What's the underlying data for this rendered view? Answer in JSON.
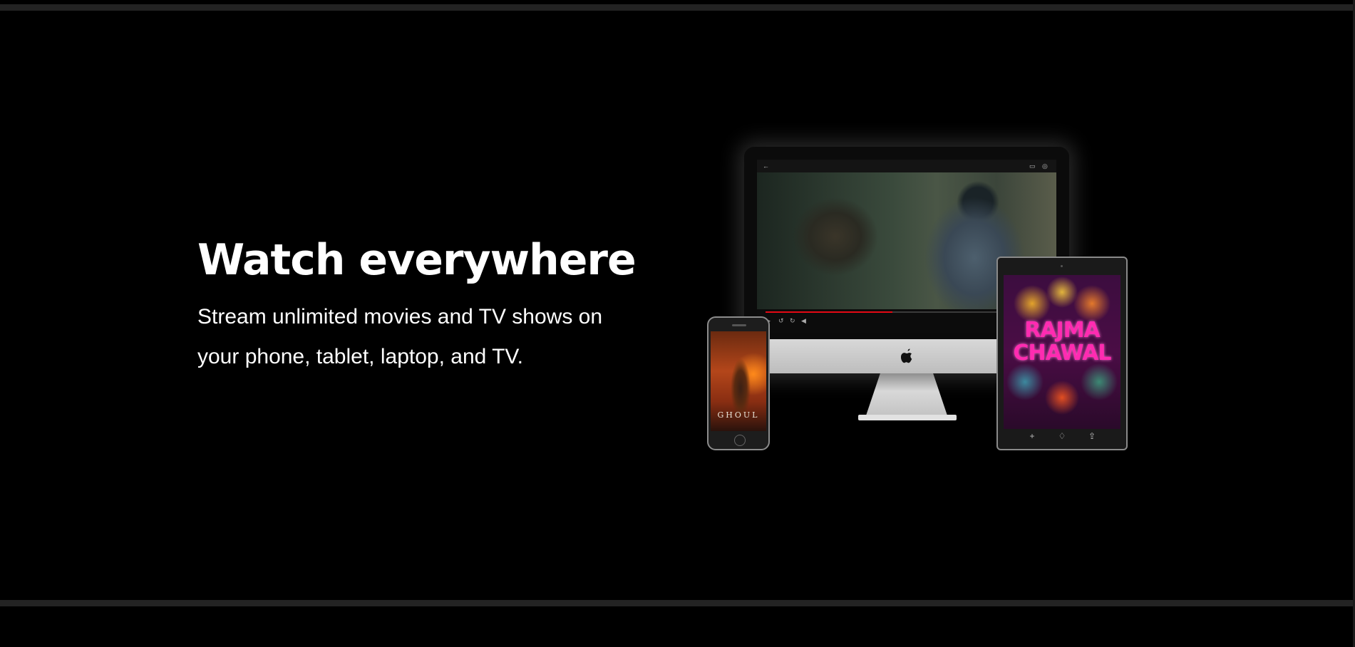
{
  "section": {
    "title": "Watch everywhere",
    "subtitle": "Stream unlimited movies and TV shows on your phone, tablet, laptop, and TV."
  },
  "devices": {
    "desktop": {
      "label": "imac",
      "logo_icon": "apple-logo-icon",
      "player": {
        "progress": 0.45,
        "accent": "#e50914",
        "icons": [
          "back-arrow-icon",
          "cast-icon",
          "settings-icon",
          "play-icon",
          "rewind-icon",
          "volume-icon"
        ]
      }
    },
    "phone": {
      "poster_title": "GHOUL"
    },
    "tablet": {
      "poster_title": "RAJMA CHAWAL",
      "icons": [
        "plus-icon",
        "like-icon",
        "share-icon"
      ]
    }
  },
  "colors": {
    "background": "#000000",
    "divider": "#232323",
    "text": "#ffffff"
  }
}
